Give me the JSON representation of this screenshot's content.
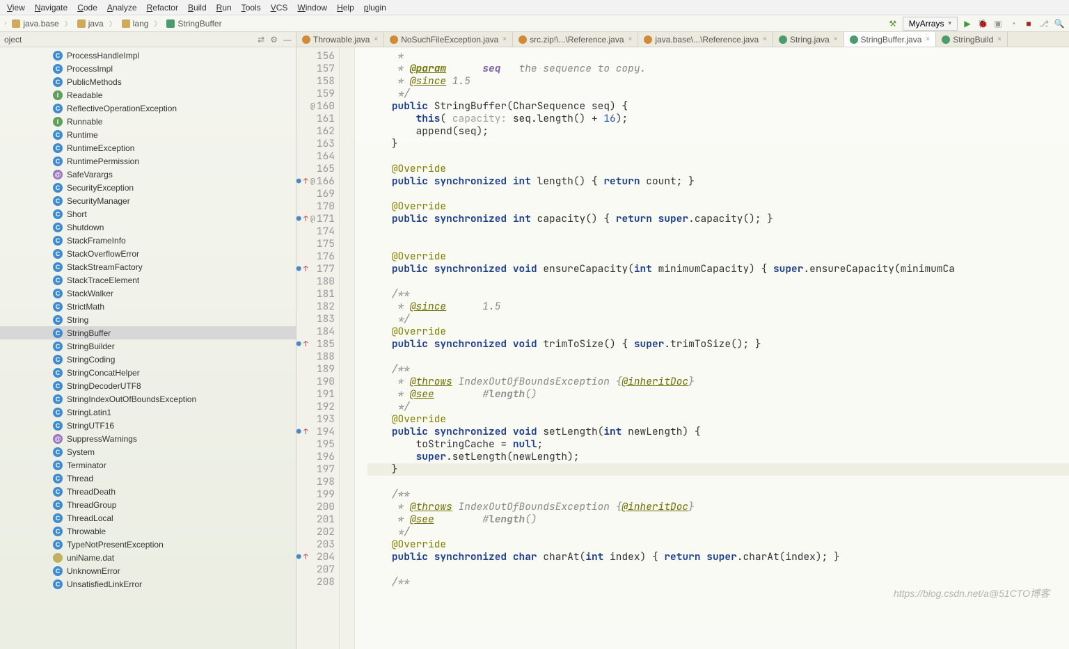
{
  "menu": [
    "View",
    "Navigate",
    "Code",
    "Analyze",
    "Refactor",
    "Build",
    "Run",
    "Tools",
    "VCS",
    "Window",
    "Help",
    "plugin"
  ],
  "breadcrumbs": [
    {
      "icon": "folder",
      "label": "java.base"
    },
    {
      "icon": "folder",
      "label": "java"
    },
    {
      "icon": "folder",
      "label": "lang"
    },
    {
      "icon": "class",
      "label": "StringBuffer"
    }
  ],
  "run_config": "MyArrays",
  "sidebar": {
    "title": "oject",
    "items": [
      {
        "k": "c",
        "n": "ProcessHandleImpl"
      },
      {
        "k": "c",
        "n": "ProcessImpl"
      },
      {
        "k": "c",
        "n": "PublicMethods"
      },
      {
        "k": "i",
        "n": "Readable"
      },
      {
        "k": "c",
        "n": "ReflectiveOperationException"
      },
      {
        "k": "i",
        "n": "Runnable"
      },
      {
        "k": "c",
        "n": "Runtime"
      },
      {
        "k": "c",
        "n": "RuntimeException"
      },
      {
        "k": "c",
        "n": "RuntimePermission"
      },
      {
        "k": "a",
        "n": "SafeVarargs"
      },
      {
        "k": "c",
        "n": "SecurityException"
      },
      {
        "k": "c",
        "n": "SecurityManager"
      },
      {
        "k": "c",
        "n": "Short"
      },
      {
        "k": "c",
        "n": "Shutdown"
      },
      {
        "k": "c",
        "n": "StackFrameInfo"
      },
      {
        "k": "c",
        "n": "StackOverflowError"
      },
      {
        "k": "c",
        "n": "StackStreamFactory"
      },
      {
        "k": "c",
        "n": "StackTraceElement"
      },
      {
        "k": "c",
        "n": "StackWalker"
      },
      {
        "k": "c",
        "n": "StrictMath"
      },
      {
        "k": "c",
        "n": "String"
      },
      {
        "k": "c",
        "n": "StringBuffer",
        "sel": true
      },
      {
        "k": "c",
        "n": "StringBuilder"
      },
      {
        "k": "c",
        "n": "StringCoding"
      },
      {
        "k": "c",
        "n": "StringConcatHelper"
      },
      {
        "k": "c",
        "n": "StringDecoderUTF8"
      },
      {
        "k": "c",
        "n": "StringIndexOutOfBoundsException"
      },
      {
        "k": "c",
        "n": "StringLatin1"
      },
      {
        "k": "c",
        "n": "StringUTF16"
      },
      {
        "k": "a",
        "n": "SuppressWarnings"
      },
      {
        "k": "c",
        "n": "System"
      },
      {
        "k": "c",
        "n": "Terminator"
      },
      {
        "k": "c",
        "n": "Thread"
      },
      {
        "k": "c",
        "n": "ThreadDeath"
      },
      {
        "k": "c",
        "n": "ThreadGroup"
      },
      {
        "k": "c",
        "n": "ThreadLocal"
      },
      {
        "k": "c",
        "n": "Throwable"
      },
      {
        "k": "c",
        "n": "TypeNotPresentException"
      },
      {
        "k": "f",
        "n": "uniName.dat"
      },
      {
        "k": "c",
        "n": "UnknownError"
      },
      {
        "k": "c",
        "n": "UnsatisfiedLinkError"
      }
    ]
  },
  "tabs": [
    {
      "ic": "o",
      "label": "Throwable.java"
    },
    {
      "ic": "o",
      "label": "NoSuchFileException.java"
    },
    {
      "ic": "o",
      "label": "src.zip!\\...\\Reference.java"
    },
    {
      "ic": "o",
      "label": "java.base\\...\\Reference.java"
    },
    {
      "ic": "c",
      "label": "String.java"
    },
    {
      "ic": "c",
      "label": "StringBuffer.java",
      "active": true
    },
    {
      "ic": "c",
      "label": "StringBuild"
    }
  ],
  "lines": [
    {
      "n": "156",
      "html": "     <span class='doc'>*</span>"
    },
    {
      "n": "157",
      "html": "     <span class='doc'>* <span class='tag2'>@param</span>      <span class='pn'>seq</span>   the sequence to copy.</span>"
    },
    {
      "n": "158",
      "html": "     <span class='doc'>* <span class='tag'>@since</span> 1.5</span>"
    },
    {
      "n": "159",
      "html": "     <span class='doc'>*/</span>"
    },
    {
      "n": "160",
      "mark": "@",
      "html": "    <span class='kw'>public</span> StringBuffer(CharSequence seq) {"
    },
    {
      "n": "161",
      "html": "        <span class='kw'>this</span>( <span class='hint'>capacity:</span> seq.length() + <span class='num'>16</span>);"
    },
    {
      "n": "162",
      "html": "        append(seq);"
    },
    {
      "n": "163",
      "html": "    }"
    },
    {
      "n": "164",
      "html": ""
    },
    {
      "n": "165",
      "html": "    <span class='ann'>@Override</span>"
    },
    {
      "n": "166",
      "mark": "o↑@",
      "html": "    <span class='kw'>public</span> <span class='kw'>synchronized</span> <span class='kw'>int</span> length() { <span class='kw'>return</span> <span class='fn'>count</span>; }"
    },
    {
      "n": "169",
      "html": ""
    },
    {
      "n": "170",
      "html": "    <span class='ann'>@Override</span>"
    },
    {
      "n": "171",
      "mark": "o↑@",
      "html": "    <span class='kw'>public</span> <span class='kw'>synchronized</span> <span class='kw'>int</span> capacity() { <span class='kw'>return</span> <span class='kw'>super</span>.capacity(); }"
    },
    {
      "n": "174",
      "html": ""
    },
    {
      "n": "175",
      "html": ""
    },
    {
      "n": "176",
      "html": "    <span class='ann'>@Override</span>"
    },
    {
      "n": "177",
      "mark": "o↑",
      "html": "    <span class='kw'>public</span> <span class='kw'>synchronized</span> <span class='kw'>void</span> ensureCapacity(<span class='kw'>int</span> minimumCapacity) { <span class='kw'>super</span>.ensureCapacity(minimumCa"
    },
    {
      "n": "180",
      "html": ""
    },
    {
      "n": "181",
      "html": "    <span class='doc'>/**</span>"
    },
    {
      "n": "182",
      "html": "     <span class='doc'>* <span class='tag'>@since</span>      1.5</span>"
    },
    {
      "n": "183",
      "html": "     <span class='doc'>*/</span>"
    },
    {
      "n": "184",
      "html": "    <span class='ann'>@Override</span>"
    },
    {
      "n": "185",
      "mark": "o↑",
      "html": "    <span class='kw'>public</span> <span class='kw'>synchronized</span> <span class='kw'>void</span> trimToSize() { <span class='kw'>super</span>.trimToSize(); }"
    },
    {
      "n": "188",
      "html": ""
    },
    {
      "n": "189",
      "html": "    <span class='doc'>/**</span>"
    },
    {
      "n": "190",
      "html": "     <span class='doc'>* <span class='tag'>@throws</span> IndexOutOfBoundsException {<span class='tag'>@inheritDoc</span>}</span>"
    },
    {
      "n": "191",
      "html": "     <span class='doc'>* <span class='tag'>@see</span>        #<b>length</b>()</span>"
    },
    {
      "n": "192",
      "html": "     <span class='doc'>*/</span>"
    },
    {
      "n": "193",
      "html": "    <span class='ann'>@Override</span>"
    },
    {
      "n": "194",
      "mark": "o↑",
      "html": "    <span class='kw'>public</span> <span class='kw'>synchronized</span> <span class='kw'>void</span> setLength(<span class='kw'>int</span> newLength) {"
    },
    {
      "n": "195",
      "html": "        toStringCache = <span class='kw'>null</span>;"
    },
    {
      "n": "196",
      "html": "        <span class='kw'>super</span>.setLength(newLength);"
    },
    {
      "n": "197",
      "hl": true,
      "html": "    }"
    },
    {
      "n": "198",
      "html": ""
    },
    {
      "n": "199",
      "html": "    <span class='doc'>/**</span>"
    },
    {
      "n": "200",
      "html": "     <span class='doc'>* <span class='tag'>@throws</span> IndexOutOfBoundsException {<span class='tag'>@inheritDoc</span>}</span>"
    },
    {
      "n": "201",
      "html": "     <span class='doc'>* <span class='tag'>@see</span>        #<b>length</b>()</span>"
    },
    {
      "n": "202",
      "html": "     <span class='doc'>*/</span>"
    },
    {
      "n": "203",
      "html": "    <span class='ann'>@Override</span>"
    },
    {
      "n": "204",
      "mark": "o↑",
      "html": "    <span class='kw'>public</span> <span class='kw'>synchronized</span> <span class='kw'>char</span> charAt(<span class='kw'>int</span> index) { <span class='kw'>return</span> <span class='kw'>super</span>.charAt(index); }"
    },
    {
      "n": "207",
      "html": ""
    },
    {
      "n": "208",
      "html": "    <span class='doc'>/**</span>"
    }
  ],
  "watermark": "https://blog.csdn.net/a@51CTO博客"
}
